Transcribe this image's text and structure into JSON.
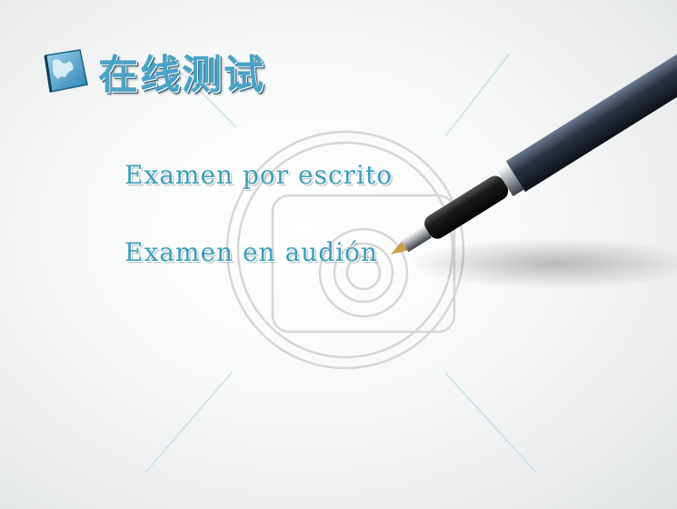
{
  "header": {
    "title": "在线测试",
    "icon": "globe-icon"
  },
  "menu": {
    "items": [
      {
        "label": "Examen por escrito"
      },
      {
        "label": "Examen en audión"
      }
    ]
  },
  "colors": {
    "accent": "#4aa3c6",
    "text": "#3f9fb9",
    "pen_body": "#1b1b1f",
    "pen_barrel": "#2b3442"
  }
}
